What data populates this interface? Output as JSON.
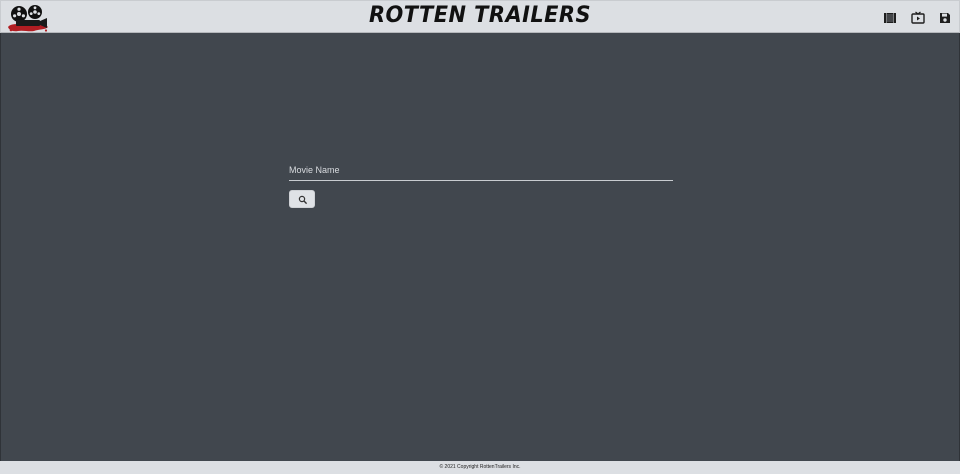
{
  "header": {
    "title": "ROTTEN TRAILERS",
    "icons": [
      "movie-library-icon",
      "trailer-play-icon",
      "save-icon"
    ]
  },
  "search": {
    "placeholder": "Movie Name",
    "value": "",
    "button_icon": "search-icon"
  },
  "footer": {
    "copyright": "© 2021 Copyright RottenTrailers Inc."
  },
  "colors": {
    "header_bg": "#dcdfe3",
    "main_bg": "#41474e",
    "logo_red": "#b11d22",
    "button_bg": "#dfe2e6"
  }
}
